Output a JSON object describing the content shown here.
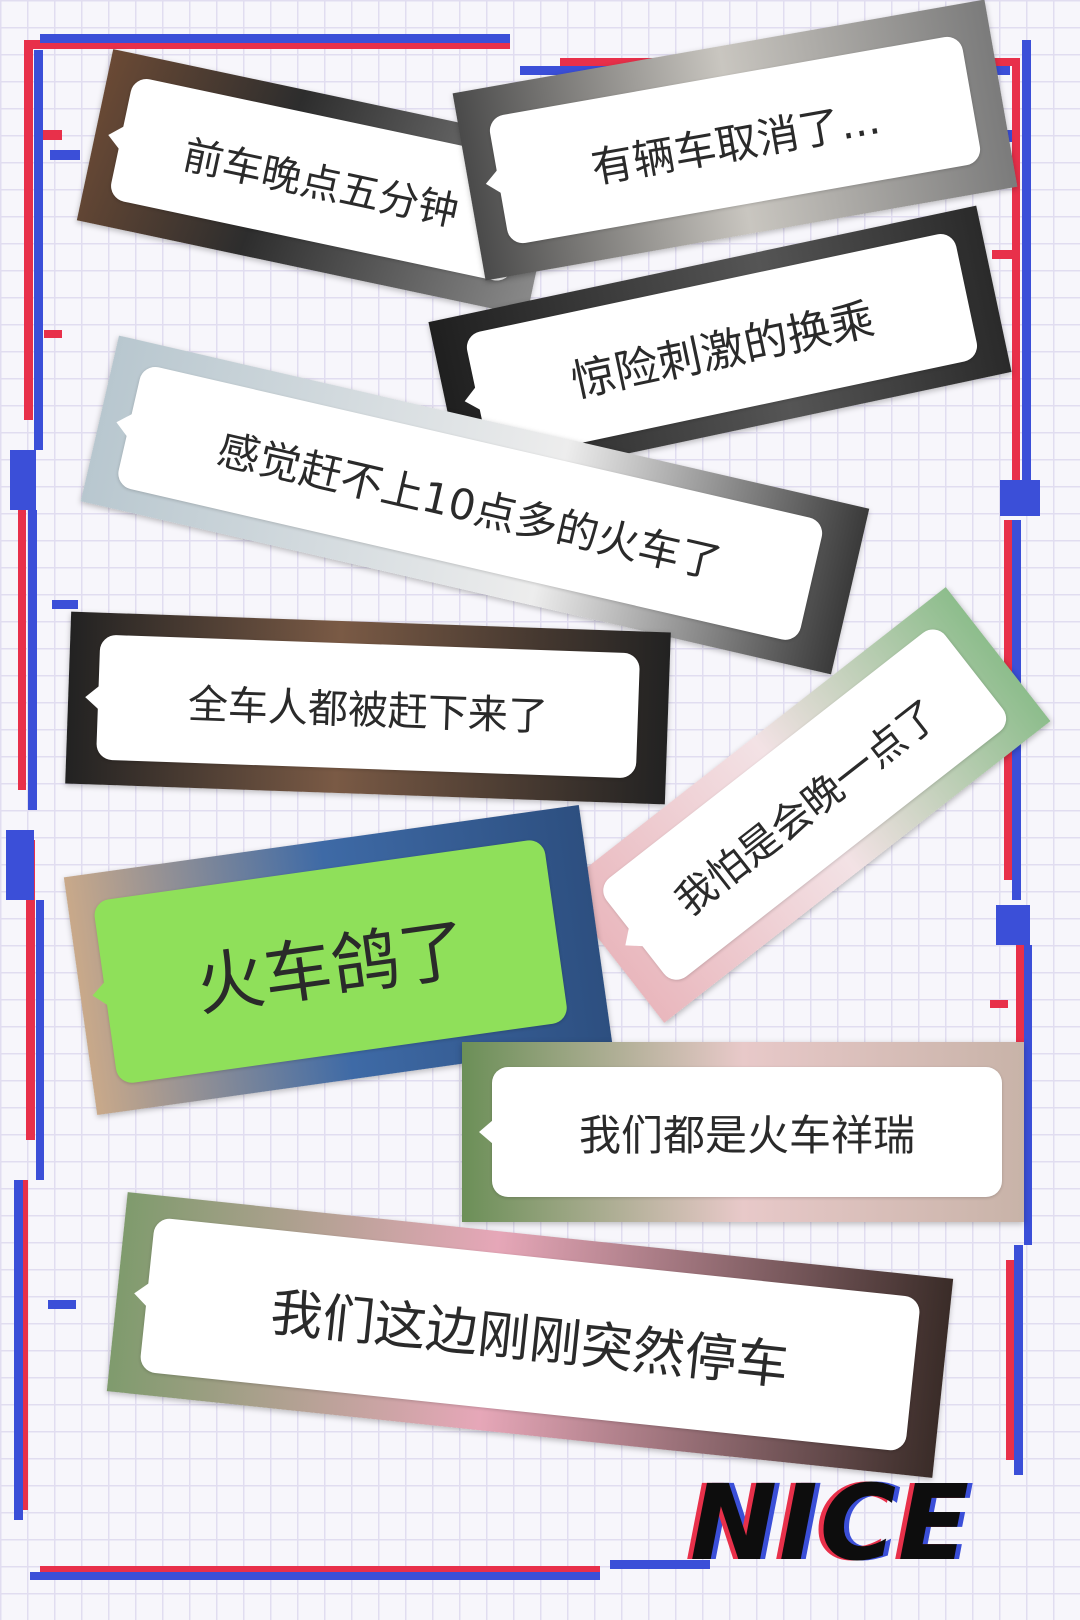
{
  "colors": {
    "frame_blue": "#3b4fd8",
    "frame_red": "#e8304a",
    "bubble_white": "#ffffff",
    "bubble_green": "#8fe05a",
    "text": "#2a2a2a"
  },
  "messages": [
    {
      "id": "m1",
      "text": "前车晚点五分钟"
    },
    {
      "id": "m2",
      "text": "有辆车取消了..."
    },
    {
      "id": "m3",
      "text": "惊险刺激的换乘"
    },
    {
      "id": "m4",
      "text": "感觉赶不上10点多的火车了"
    },
    {
      "id": "m5",
      "text": "全车人都被赶下来了"
    },
    {
      "id": "m6",
      "text": "我怕是会晚一点了"
    },
    {
      "id": "m7",
      "text": "火车鸽了"
    },
    {
      "id": "m8",
      "text": "我们都是火车祥瑞"
    },
    {
      "id": "m9",
      "text": "我们这边刚刚突然停车"
    }
  ],
  "logo": {
    "text": "NICE"
  }
}
